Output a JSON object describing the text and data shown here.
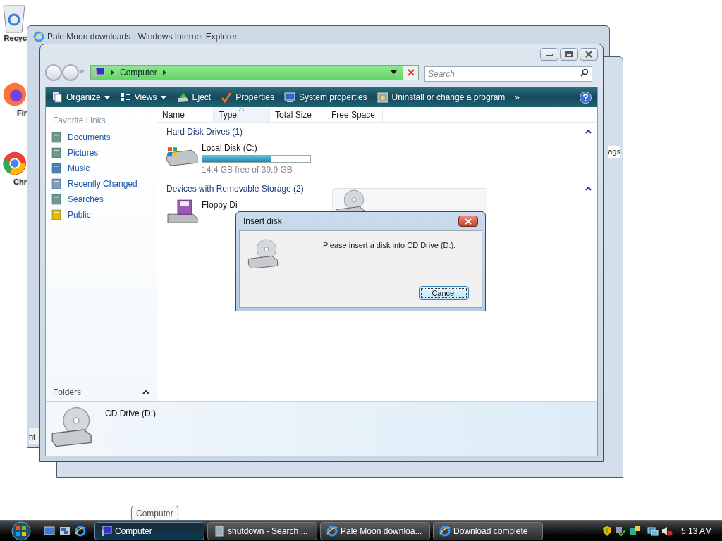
{
  "desktop_icons": [
    {
      "label": "Recyc",
      "kind": "recycle"
    },
    {
      "label": "Fir",
      "kind": "browser-fox"
    },
    {
      "label": "Chr",
      "kind": "browser-ring"
    }
  ],
  "back_windows": {
    "browser": {
      "title": "Pale Moon downloads - Windows Internet Explorer",
      "status_text": "ht"
    },
    "other": {
      "fragment_text": "ags"
    }
  },
  "explorer": {
    "address": [
      "Computer"
    ],
    "search": {
      "placeholder": "Search"
    },
    "toolbar": [
      {
        "label": "Organize",
        "kind": "organize",
        "dropdown": true
      },
      {
        "label": "Views",
        "kind": "views",
        "dropdown": true
      },
      {
        "label": "Eject",
        "kind": "eject",
        "dropdown": false
      },
      {
        "label": "Properties",
        "kind": "properties",
        "dropdown": false
      },
      {
        "label": "System properties",
        "kind": "system",
        "dropdown": false
      },
      {
        "label": "Uninstall or change a program",
        "kind": "uninstall",
        "dropdown": false
      }
    ],
    "more": "»",
    "favorite_links_title": "Favorite Links",
    "favorite_links": [
      {
        "label": "Documents",
        "kind": "documents"
      },
      {
        "label": "Pictures",
        "kind": "pictures"
      },
      {
        "label": "Music",
        "kind": "music"
      },
      {
        "label": "Recently Changed",
        "kind": "recent"
      },
      {
        "label": "Searches",
        "kind": "searches"
      },
      {
        "label": "Public",
        "kind": "public"
      }
    ],
    "folders_label": "Folders",
    "columns": [
      {
        "label": "Name",
        "sorted": false
      },
      {
        "label": "Type",
        "sorted": true
      },
      {
        "label": "Total Size",
        "sorted": false
      },
      {
        "label": "Free Space",
        "sorted": false
      }
    ],
    "groups": [
      {
        "title": "Hard Disk Drives (1)",
        "expanded": true,
        "items": [
          {
            "kind": "hdd",
            "name": "Local Disk (C:)",
            "level": 0.64,
            "caption": "14.4 GB free of 39.9 GB",
            "selected": false
          }
        ]
      },
      {
        "title": "Devices with Removable Storage (2)",
        "expanded": true,
        "items": [
          {
            "kind": "floppy",
            "name": "Floppy Di",
            "selected": false
          },
          {
            "kind": "cd",
            "selected": true
          }
        ]
      }
    ],
    "details": {
      "name": "CD Drive (D:)"
    }
  },
  "dialog": {
    "title": "Insert disk",
    "message": "Please insert a disk into CD Drive (D:).",
    "button": "Cancel"
  },
  "tooltip": "Computer",
  "taskbar": {
    "buttons": [
      {
        "label": "Computer",
        "kind": "computer",
        "selected": true
      },
      {
        "label": "shutdown - Search ...",
        "kind": "search",
        "selected": false
      },
      {
        "label": "Pale Moon downloa...",
        "kind": "browser",
        "selected": false
      },
      {
        "label": "Download complete",
        "kind": "browser",
        "selected": false
      }
    ],
    "clock": "5:13 AM"
  }
}
